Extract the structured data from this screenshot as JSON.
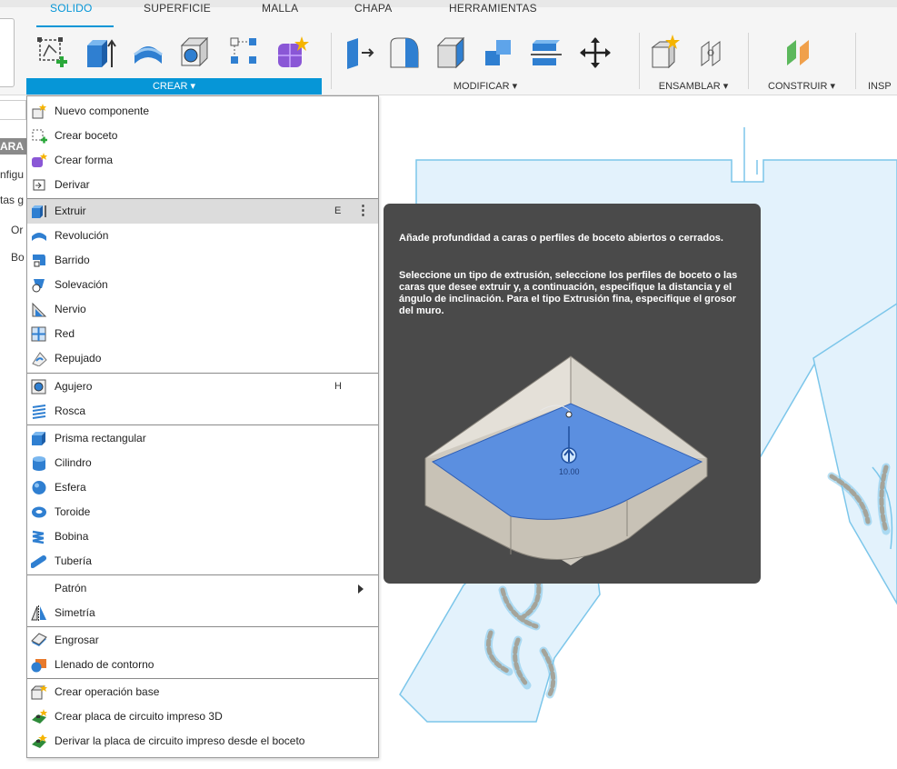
{
  "tabs": [
    "SOLIDO",
    "SUPERFICIE",
    "MALLA",
    "CHAPA",
    "HERRAMIENTAS"
  ],
  "groups": {
    "crear": "CREAR ▾",
    "modificar": "MODIFICAR ▾",
    "ensamblar": "ENSAMBLAR ▾",
    "construir": "CONSTRUIR ▾",
    "inspeccionar": "INSP"
  },
  "browser": {
    "header": "ARA",
    "rows": [
      "nfigu",
      "tas g",
      "Or",
      "Bo"
    ]
  },
  "menu": {
    "items": [
      {
        "label": "Nuevo componente",
        "icon": "new-component-icon"
      },
      {
        "label": "Crear boceto",
        "icon": "create-sketch-icon"
      },
      {
        "label": "Crear forma",
        "icon": "create-form-icon"
      },
      {
        "label": "Derivar",
        "icon": "derive-icon"
      },
      {
        "label": "Extruir",
        "icon": "extrude-icon",
        "shortcut": "E"
      },
      {
        "label": "Revolución",
        "icon": "revolve-icon"
      },
      {
        "label": "Barrido",
        "icon": "sweep-icon"
      },
      {
        "label": "Solevación",
        "icon": "loft-icon"
      },
      {
        "label": "Nervio",
        "icon": "rib-icon"
      },
      {
        "label": "Red",
        "icon": "web-icon"
      },
      {
        "label": "Repujado",
        "icon": "emboss-icon"
      },
      {
        "label": "Agujero",
        "icon": "hole-icon",
        "shortcut": "H"
      },
      {
        "label": "Rosca",
        "icon": "thread-icon"
      },
      {
        "label": "Prisma rectangular",
        "icon": "box-icon"
      },
      {
        "label": "Cilindro",
        "icon": "cylinder-icon"
      },
      {
        "label": "Esfera",
        "icon": "sphere-icon"
      },
      {
        "label": "Toroide",
        "icon": "torus-icon"
      },
      {
        "label": "Bobina",
        "icon": "coil-icon"
      },
      {
        "label": "Tubería",
        "icon": "pipe-icon"
      },
      {
        "label": "Patrón",
        "icon": "pattern-submenu"
      },
      {
        "label": "Simetría",
        "icon": "mirror-icon"
      },
      {
        "label": "Engrosar",
        "icon": "thicken-icon"
      },
      {
        "label": "Llenado de contorno",
        "icon": "boundary-fill-icon"
      },
      {
        "label": "Crear operación base",
        "icon": "base-feature-icon"
      },
      {
        "label": "Crear placa de circuito impreso 3D",
        "icon": "pcb-3d-icon"
      },
      {
        "label": "Derivar la placa de circuito impreso desde el boceto",
        "icon": "pcb-derive-icon"
      }
    ]
  },
  "tooltip": {
    "paragraph1": "Añade profundidad a caras o perfiles de boceto abiertos o cerrados.",
    "paragraph2": "Seleccione un tipo de extrusión, seleccione los perfiles de boceto o las caras que desee extruir y, a continuación, especifique la distancia y el ángulo de inclinación. Para el tipo Extrusión fina, especifique el grosor del muro.",
    "dimension": "10.00"
  },
  "colors": {
    "accent": "#0696d7",
    "tooltip_bg": "#4a4a4a",
    "sketch_fill": "#dff0fb",
    "sketch_line": "#76c4e8",
    "profile_fill": "#5b8fe0"
  }
}
